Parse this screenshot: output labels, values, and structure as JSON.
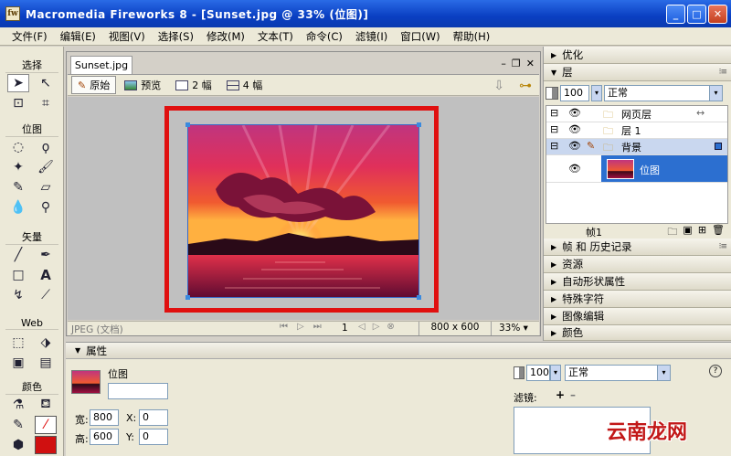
{
  "window": {
    "title": "Macromedia Fireworks 8 - [Sunset.jpg @  33% (位图)]",
    "icon_letter": "fw"
  },
  "menu": [
    "文件(F)",
    "编辑(E)",
    "视图(V)",
    "选择(S)",
    "修改(M)",
    "文本(T)",
    "命令(C)",
    "滤镜(I)",
    "窗口(W)",
    "帮助(H)"
  ],
  "toolbox": {
    "sections": [
      "选择",
      "位图",
      "矢量",
      "Web",
      "颜色"
    ]
  },
  "document": {
    "tab": "Sunset.jpg",
    "views": [
      "原始",
      "预览",
      "2 幅",
      "4 幅"
    ],
    "status": {
      "format": "JPEG (文档)",
      "frame": "1",
      "dimensions": "800 x 600",
      "zoom": "33%"
    }
  },
  "properties": {
    "title": "属性",
    "object_type": "位图",
    "width_label": "宽:",
    "width": "800",
    "height_label": "高:",
    "height": "600",
    "x_label": "X:",
    "x": "0",
    "y_label": "Y:",
    "y": "0",
    "opacity": "100",
    "blend": "正常",
    "filters_label": "滤镜:"
  },
  "panels": {
    "optimize": "优化",
    "layers": "层",
    "layers_opacity": "100",
    "layers_blend": "正常",
    "layer_rows": [
      "网页层",
      "层 1",
      "背景",
      "位图"
    ],
    "frame_label": "帧1",
    "collapsed": [
      "帧 和 历史记录",
      "资源",
      "自动形状属性",
      "特殊字符",
      "图像编辑",
      "颜色"
    ]
  },
  "watermark": "云南龙网",
  "colors": {
    "titlebar": "#0a3fc2",
    "frame_red": "#e01010",
    "selection_blue": "#2c6fd0"
  }
}
